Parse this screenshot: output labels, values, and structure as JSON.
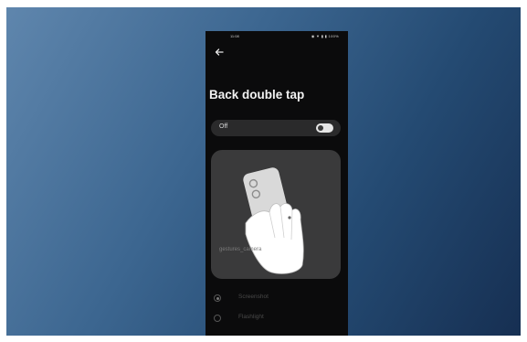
{
  "status_bar": {
    "time": "11:08",
    "icons_text": "◉ ▼ ▮ ▮ 100%"
  },
  "icons": {
    "back": "back-arrow-icon"
  },
  "page": {
    "title": "Back double tap"
  },
  "toggle": {
    "label": "Off",
    "state": "off"
  },
  "illustration": {
    "caption": "gestures_camera"
  },
  "options": [
    {
      "label": "Screenshot",
      "selected": true
    },
    {
      "label": "Flashlight",
      "selected": false
    }
  ],
  "colors": {
    "background_gradient_start": "#5f86ad",
    "background_gradient_end": "#162f52",
    "phone_background": "#0b0b0c",
    "card_background": "#3a3a3b",
    "toggle_row_background": "#2a2a2b"
  }
}
